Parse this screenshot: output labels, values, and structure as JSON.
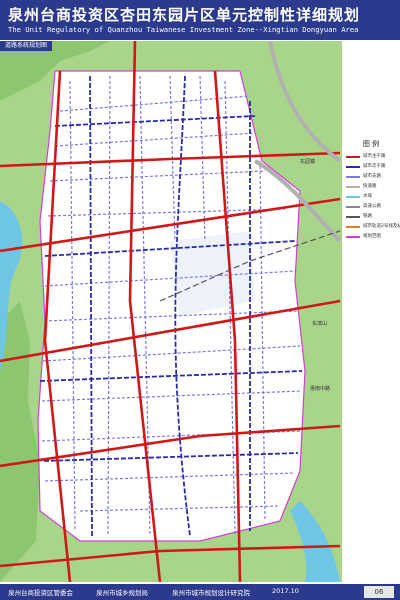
{
  "title": "泉州台商投资区杏田东园片区单元控制性详细规划",
  "subtitle": "The Unit Regulatory of Quanzhou Taiwanese Investment Zone--Xingtian Dongyuan Area",
  "sheet_label": "道路系统规划图",
  "legend": {
    "heading": "图    例",
    "items": [
      {
        "label": "城市主干路",
        "color": "#d01818"
      },
      {
        "label": "城市次干路",
        "color": "#2a2ab0"
      },
      {
        "label": "城市支路",
        "color": "#7a7ae0"
      },
      {
        "label": "快速路",
        "color": "#b0b0b0"
      },
      {
        "label": "水域",
        "color": "#6fc6e4"
      },
      {
        "label": "高速公路",
        "color": "#888888"
      },
      {
        "label": "铁路",
        "color": "#555555"
      },
      {
        "label": "城市轨道2号线及站点",
        "color": "#e08020"
      },
      {
        "label": "规划范围",
        "color": "#d040d0"
      }
    ]
  },
  "map_labels": {
    "place_1": "东园镇",
    "place_2": "惠南中路",
    "place_3": "东滨山"
  },
  "colors": {
    "header": "#2b3a8c",
    "primary_road": "#d01818",
    "secondary_road": "#2a2ab0",
    "branch_road": "#7a7ae0",
    "water": "#6fc6e4",
    "green": "#9ccf7a",
    "boundary": "#d040d0"
  },
  "footer": {
    "org1": "泉州台商投资区管委会",
    "org2": "泉州市城乡规划局",
    "org3": "泉州市城市规划设计研究院",
    "date": "2017.10",
    "sheet_no": "06"
  }
}
